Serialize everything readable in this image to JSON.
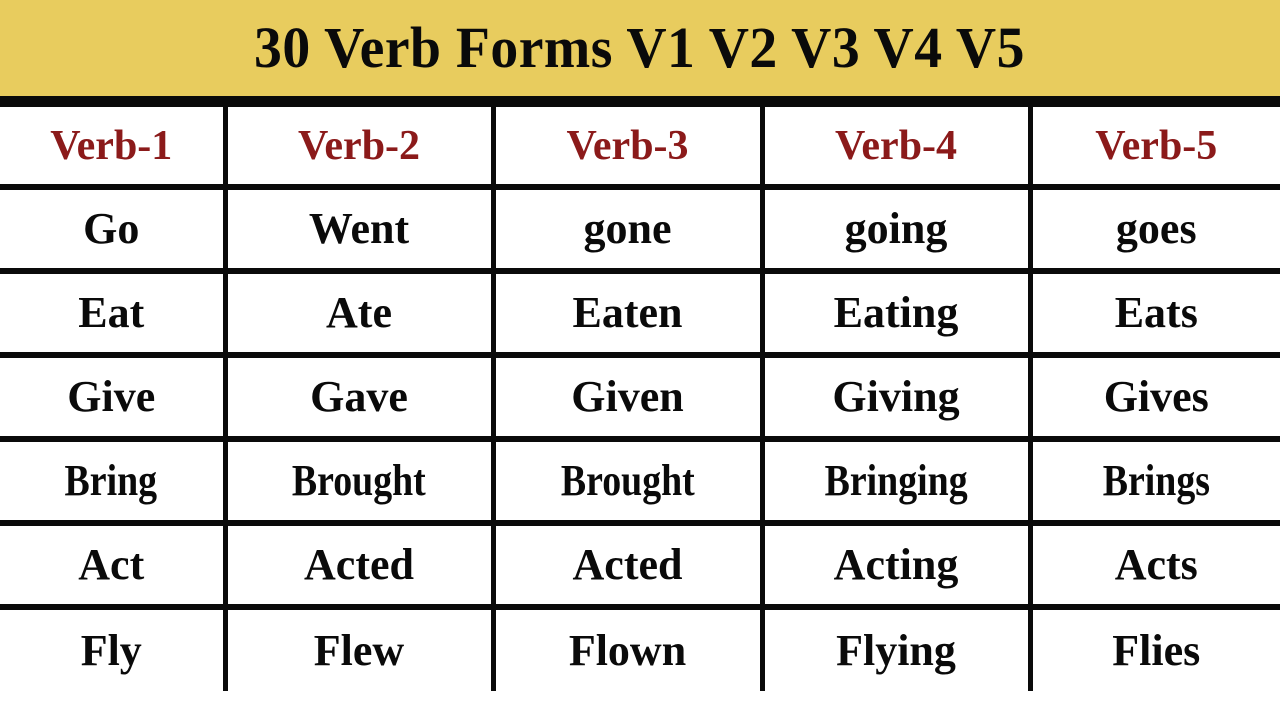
{
  "banner": {
    "title": "30 Verb Forms V1 V2 V3 V4 V5",
    "background_color": "#e8cc5e",
    "text_color": "#0a0a0a"
  },
  "colors": {
    "accent_gold": "#e8cc5e",
    "header_maroon": "#8b1a1a",
    "grid_black": "#0a0a0a",
    "cell_white": "#ffffff"
  },
  "table": {
    "headers": [
      "Verb-1",
      "Verb-2",
      "Verb-3",
      "Verb-4",
      "Verb-5"
    ],
    "rows": [
      [
        "Go",
        "Went",
        "gone",
        "going",
        "goes"
      ],
      [
        "Eat",
        "Ate",
        "Eaten",
        "Eating",
        "Eats"
      ],
      [
        "Give",
        "Gave",
        "Given",
        "Giving",
        "Gives"
      ],
      [
        "Bring",
        "Brought",
        "Brought",
        "Bringing",
        "Brings"
      ],
      [
        "Act",
        "Acted",
        "Acted",
        "Acting",
        "Acts"
      ],
      [
        "Fly",
        "Flew",
        "Flown",
        "Flying",
        "Flies"
      ]
    ]
  }
}
